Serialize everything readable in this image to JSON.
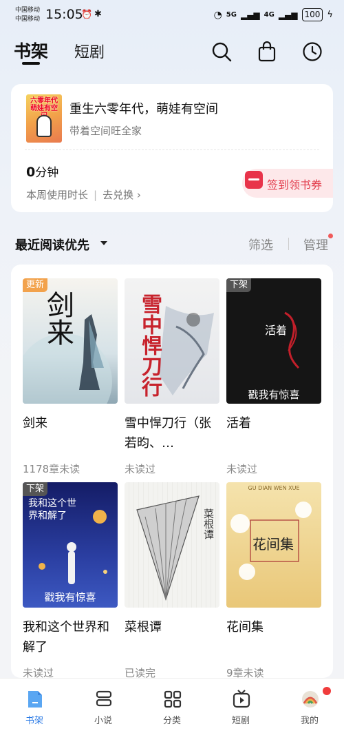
{
  "status_bar": {
    "carrier1": "中国移动",
    "carrier2": "中国移动",
    "time": "15:05",
    "signal1": "5G",
    "signal2": "4G",
    "battery": "100"
  },
  "header": {
    "tabs": [
      {
        "label": "书架",
        "active": true
      },
      {
        "label": "短剧",
        "active": false
      }
    ],
    "icons": [
      "search-icon",
      "bag-icon",
      "clock-icon"
    ]
  },
  "recent": {
    "title": "重生六零年代，萌娃有空间",
    "subtitle": "带着空间旺全家",
    "cover_text": "六零年代萌娃有空间",
    "minutes_value": "0",
    "minutes_unit": "分钟",
    "usage_label": "本周使用时长",
    "redeem_label": "去兑换",
    "signin_label": "签到领书券"
  },
  "sort": {
    "label": "最近阅读优先",
    "filter": "筛选",
    "manage": "管理"
  },
  "books": [
    {
      "title": "剑来",
      "status": "1178章未读",
      "badge": "更新",
      "cover_title": "剑来",
      "colors": [
        "#f4f2ee",
        "#c8d7dd"
      ]
    },
    {
      "title": "雪中悍刀行（张若昀、…",
      "status": "未读过",
      "badge": "",
      "cover_title": "雪中悍刀行",
      "colors": [
        "#f1f1f1",
        "#dfe3e8"
      ]
    },
    {
      "title": "活着",
      "status": "未读过",
      "badge": "下架",
      "cover_title": "活着",
      "cover_caption": "戳我有惊喜",
      "colors": [
        "#141414",
        "#1f1f1f"
      ]
    },
    {
      "title": "我和这个世界和解了",
      "status": "未读过",
      "badge": "下架",
      "cover_title": "我和这个世界和解了",
      "cover_caption": "戳我有惊喜",
      "colors": [
        "#16206e",
        "#3a52b8"
      ]
    },
    {
      "title": "菜根谭",
      "status": "已读完",
      "badge": "",
      "cover_title": "菜根谭",
      "colors": [
        "#f3f3f0",
        "#e2e2de"
      ]
    },
    {
      "title": "花间集",
      "status": "9章未读",
      "badge": "",
      "cover_title": "花间集",
      "cover_caption": "GU DIAN WEN XUE",
      "colors": [
        "#f4e0a6",
        "#e8c874"
      ]
    }
  ],
  "tabbar": {
    "items": [
      {
        "label": "书架",
        "icon": "bookshelf-icon",
        "active": true
      },
      {
        "label": "小说",
        "icon": "novel-icon",
        "active": false
      },
      {
        "label": "分类",
        "icon": "category-icon",
        "active": false
      },
      {
        "label": "短剧",
        "icon": "short-drama-icon",
        "active": false
      },
      {
        "label": "我的",
        "icon": "profile-icon",
        "active": false
      }
    ]
  },
  "colors": {
    "accent": "#2c7be5",
    "signin": "#e23a4a",
    "badge_new": "#f2a24c",
    "badge_off": "#555555"
  }
}
